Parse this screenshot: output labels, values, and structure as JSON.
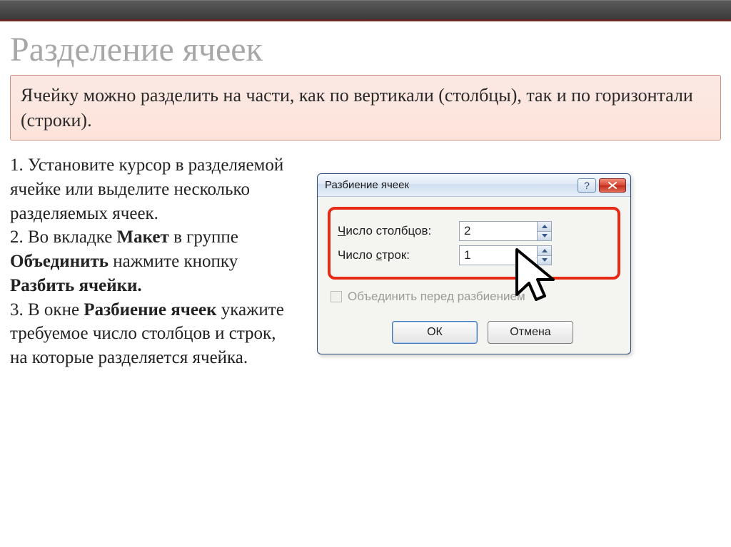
{
  "slide": {
    "title": "Разделение ячеек",
    "intro": "Ячейку можно разделить на части, как по вертикали (столбцы), так и по горизонтали (строки)."
  },
  "steps": {
    "s1": "1. Установите курсор в разделяемой ячейке или выделите несколько разделяемых ячеек.",
    "s2a": "2. Во вкладке ",
    "s2b": "Макет",
    "s2c": " в группе ",
    "s2d": "Объединить",
    "s2e": " нажмите кнопку ",
    "s2f": "Разбить ячейки.",
    "s3a": "3. В окне ",
    "s3b": "Разбиение ячеек",
    "s3c": "  укажите требуемое число столбцов и строк, на которые разделяется ячейка."
  },
  "dialog": {
    "title": "Разбиение ячеек",
    "help": "?",
    "col_label_pre": "Ч",
    "col_label_rest": "исло столбцов:",
    "col_value": "2",
    "row_label_text": "Число ",
    "row_label_ul": "с",
    "row_label_post": "трок:",
    "row_value": "1",
    "merge_cb": "Объединить перед разбиением",
    "ok": "ОК",
    "cancel": "Отмена"
  }
}
